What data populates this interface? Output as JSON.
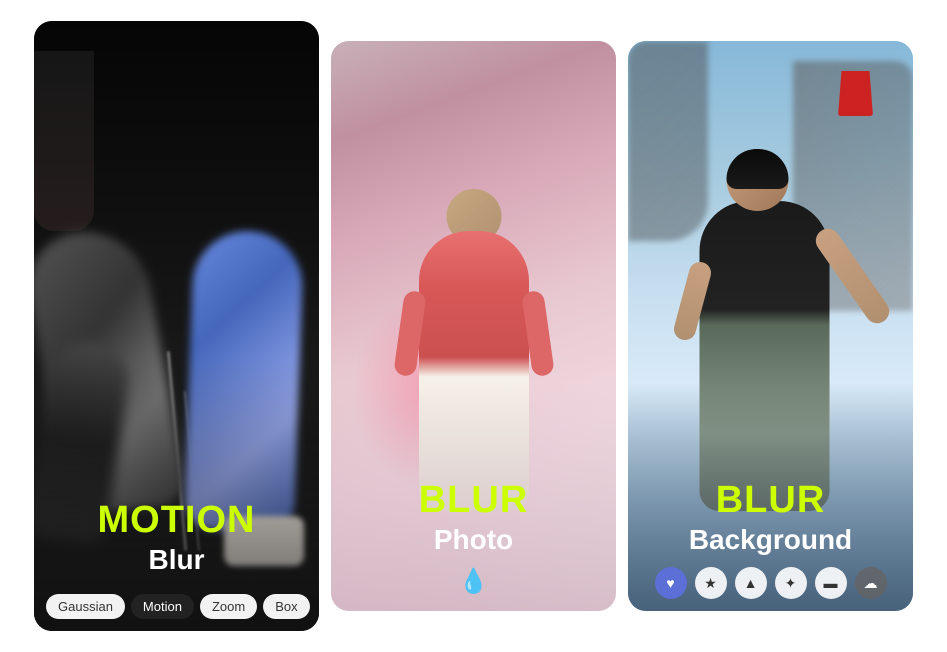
{
  "cards": [
    {
      "id": "motion-blur",
      "title_green": "MOTION",
      "title_white": "",
      "subtitle": "Blur",
      "controls": [
        {
          "label": "Gaussian",
          "active": false
        },
        {
          "label": "Motion",
          "active": true
        },
        {
          "label": "Zoom",
          "active": false
        },
        {
          "label": "Box",
          "active": false
        }
      ],
      "control_type": "pills"
    },
    {
      "id": "blur-photo",
      "title_green": "BLUR",
      "title_white": "",
      "subtitle": "Photo",
      "control_type": "waterdrop"
    },
    {
      "id": "blur-background",
      "title_green": "BLUR",
      "title_white": "",
      "subtitle": "Background",
      "control_type": "icons",
      "icons": [
        "♥",
        "★",
        "▲",
        "✦",
        "▬",
        "☁"
      ]
    }
  ]
}
